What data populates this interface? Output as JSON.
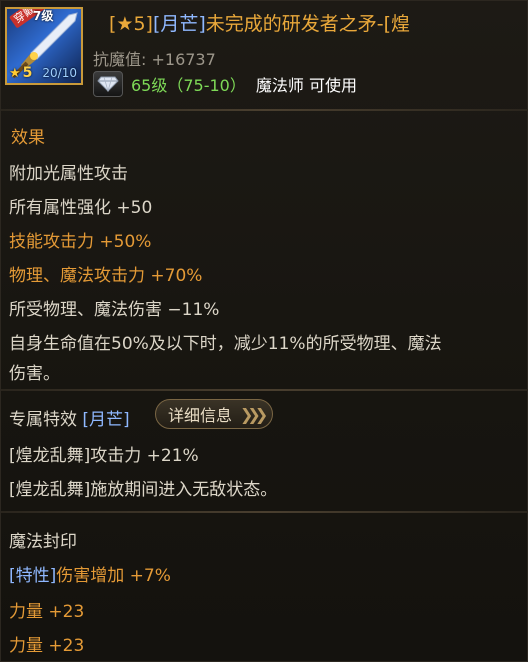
{
  "header": {
    "item_name_prefix": "[★5]",
    "item_name_mark": "[月芒]",
    "item_name_rest": "未完成的研发者之矛-[煌",
    "stat_label": "抗魔值: +16737",
    "req_level": "65级（75-10）",
    "req_class": "魔法师 可使用",
    "icon": {
      "equip_badge": "穿戴中",
      "grade_badge": "7级",
      "reinforce_level": "5",
      "durability": "20/10",
      "icon_name": "spear-icon"
    }
  },
  "effects": {
    "title": "效果",
    "lines": [
      "附加光属性攻击",
      "所有属性强化 +50",
      "技能攻击力 +50%",
      "物理、魔法攻击力 +70%",
      "所受物理、魔法伤害 −11%",
      "自身生命值在50%及以下时，减少11%的所受物理、魔法",
      "伤害。"
    ]
  },
  "exclusive": {
    "title": "专属特效",
    "mark": "[月芒]",
    "detail_button": "详细信息",
    "lines": [
      "[煌龙乱舞]攻击力 +21%",
      "[煌龙乱舞]施放期间进入无敌状态。"
    ]
  },
  "seal": {
    "title": "魔法封印",
    "trait_tag": "[特性]",
    "trait_text": "伤害增加 +7%",
    "lines": [
      "力量 +23",
      "力量 +23"
    ]
  },
  "colors": {
    "orange": "#e49a36",
    "white": "#dcd6c8",
    "blue": "#8fb8ff",
    "green": "#7ed957"
  }
}
